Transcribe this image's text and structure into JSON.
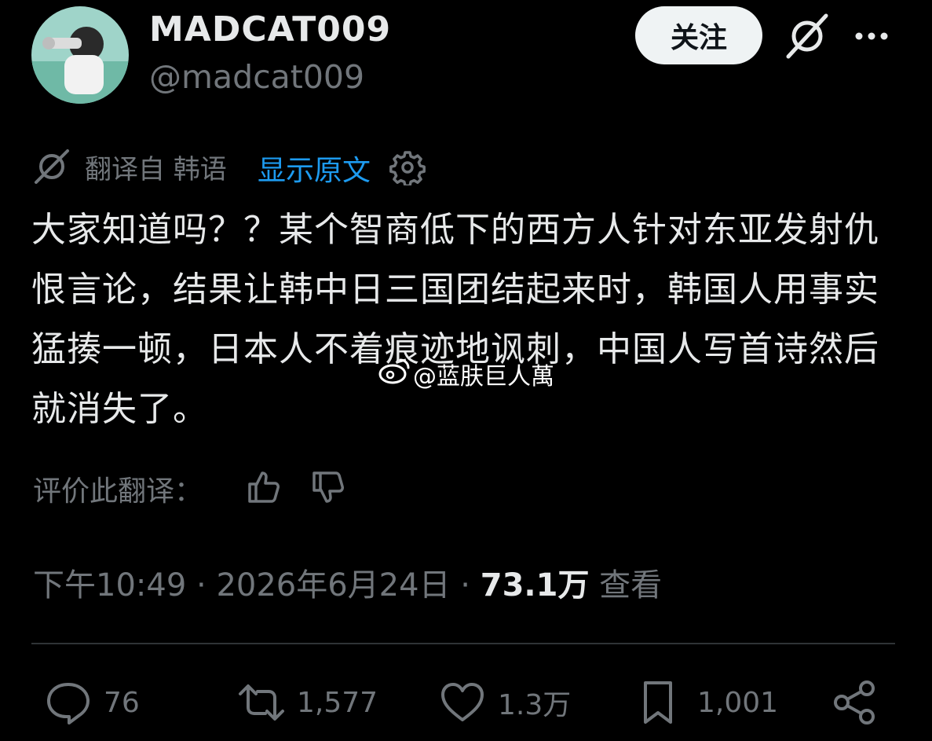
{
  "author": {
    "display_name": "MADCAT009",
    "handle": "@madcat009",
    "follow_label": "关注"
  },
  "translation": {
    "from_label": "翻译自 韩语",
    "show_original_label": "显示原文"
  },
  "tweet": {
    "text": "大家知道吗？？某个智商低下的西方人针对东亚发射仇恨言论，结果让韩中日三国团结起来时，韩国人用事实猛揍一顿，日本人不着痕迹地讽刺，中国人写首诗然后就消失了。"
  },
  "watermark": {
    "text": "@蓝肤巨人萬"
  },
  "rate_translation": {
    "label": "评价此翻译："
  },
  "meta": {
    "time": "下午10:49",
    "sep1": " · ",
    "date": "2026年6月24日",
    "sep2": " · ",
    "views_count": "73.1万",
    "views_label": " 查看"
  },
  "actions": {
    "replies": "76",
    "retweets": "1,577",
    "likes": "1.3万",
    "bookmarks": "1,001"
  },
  "colors": {
    "background": "#000000",
    "text_primary": "#e7e9ea",
    "text_secondary": "#71767b",
    "link": "#1d9bf0",
    "follow_bg": "#eff3f4",
    "divider": "#2f3336"
  },
  "icons": {
    "grok": "grok-icon",
    "more": "more-icon",
    "translate": "grok-translate-icon",
    "settings": "gear-icon",
    "thumb_up": "thumb-up-icon",
    "thumb_down": "thumb-down-icon",
    "reply": "reply-icon",
    "retweet": "retweet-icon",
    "like": "heart-icon",
    "bookmark": "bookmark-icon",
    "share": "share-icon"
  }
}
